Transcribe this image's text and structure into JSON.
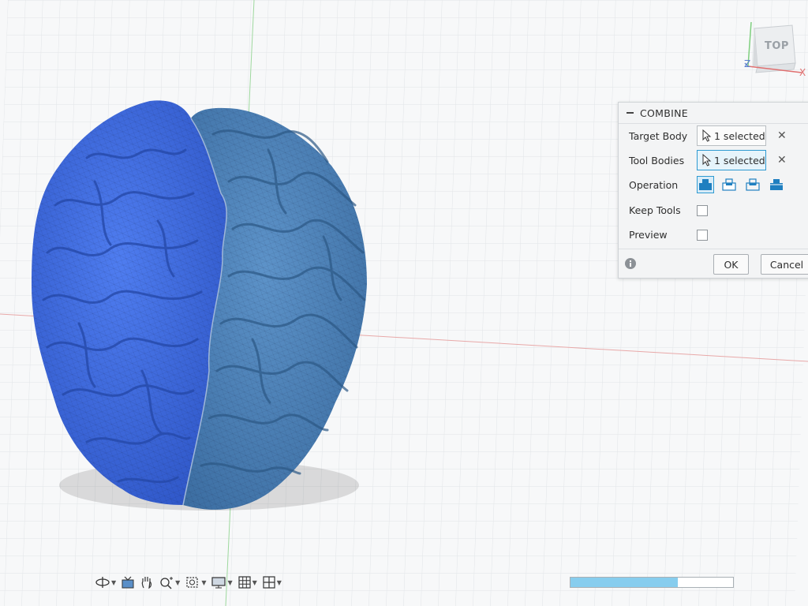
{
  "dialog": {
    "title": "COMBINE",
    "target_body": {
      "label": "Target Body",
      "value": "1 selected"
    },
    "tool_bodies": {
      "label": "Tool Bodies",
      "value": "1 selected"
    },
    "operation": {
      "label": "Operation",
      "options": [
        "join-icon",
        "cut-icon",
        "intersect-icon",
        "new-body-icon"
      ],
      "selected": "join-icon"
    },
    "keep_tools": {
      "label": "Keep Tools",
      "checked": false
    },
    "preview": {
      "label": "Preview",
      "checked": false
    },
    "ok": "OK",
    "cancel": "Cancel"
  },
  "viewcube": {
    "face": "TOP",
    "axes": [
      "Z",
      "X"
    ]
  },
  "navbar": [
    "orbit-icon",
    "look-at-icon",
    "pan-icon",
    "zoom-icon",
    "fit-icon",
    "display-settings-icon",
    "grid-icon",
    "viewports-icon"
  ],
  "progress": {
    "fraction": 0.66
  },
  "colors": {
    "left_body": "#3d6be0",
    "right_body": "#4c80b8",
    "accent": "#2e9ad1",
    "progress": "#87cdee"
  }
}
